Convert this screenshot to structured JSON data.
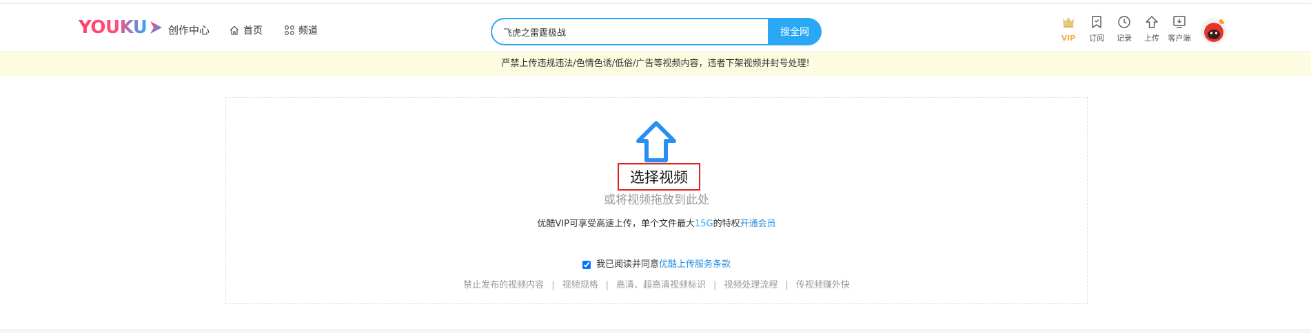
{
  "header": {
    "logo_text": "YOUKU",
    "creator_center": "创作中心",
    "nav": {
      "home": "首页",
      "channel": "频道"
    },
    "search": {
      "value": "飞虎之雷霆极战",
      "button": "搜全网"
    },
    "tools": {
      "vip": "VIP",
      "subscribe": "订阅",
      "history": "记录",
      "upload": "上传",
      "client": "客户端"
    },
    "colors": {
      "accent": "#2aa8f6",
      "brand_pink": "#ff3f6c",
      "vip_gold": "#f0b23c"
    }
  },
  "notice": "严禁上传违规违法/色情色诱/低俗/广告等视频内容，违者下架视频并封号处理!",
  "upload": {
    "select_button": "选择视频",
    "drag_hint": "或将视频拖放到此处",
    "vip_hint_prefix": "优酷VIP可享受高速上传，单个文件最大",
    "vip_hint_size": "15G",
    "vip_hint_suffix": "的特权",
    "vip_link": "开通会员",
    "agree_text": "我已阅读并同意",
    "agree_link": "优酷上传服务条款",
    "agree_checked": true,
    "links": [
      "禁止发布的视频内容",
      "视频规格",
      "高清、超高清视频标识",
      "视频处理流程",
      "传视频赚外快"
    ]
  }
}
